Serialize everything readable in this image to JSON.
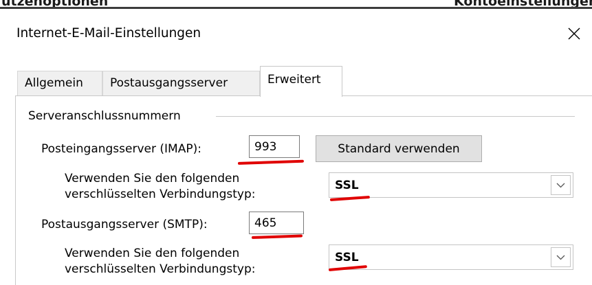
{
  "background_window": {
    "left_fragment": "utzenoptionen",
    "right_fragment": "Kontoeinstellungen"
  },
  "dialog": {
    "title": "Internet-E-Mail-Einstellungen",
    "close_icon": "close-icon"
  },
  "tabs": [
    {
      "label": "Allgemein",
      "active": false
    },
    {
      "label": "Postausgangsserver",
      "active": false
    },
    {
      "label": "Erweitert",
      "active": true
    }
  ],
  "server_ports": {
    "group_label": "Serveranschlussnummern",
    "incoming_label": "Posteingangsserver (IMAP):",
    "incoming_port": "993",
    "default_button": "Standard verwenden",
    "incoming_encryption_label_line1": "Verwenden Sie den folgenden",
    "incoming_encryption_label_line2": "verschlüsselten Verbindungstyp:",
    "incoming_encryption": "SSL",
    "outgoing_label": "Postausgangsserver (SMTP):",
    "outgoing_port": "465",
    "outgoing_encryption_label_line1": "Verwenden Sie den folgenden",
    "outgoing_encryption_label_line2": "verschlüsselten Verbindungstyp:",
    "outgoing_encryption": "SSL"
  },
  "colors": {
    "annotation_red": "#e00000",
    "active_tab": "#ffffff",
    "inactive_tab": "#f0f0f0",
    "button_face": "#e1e1e1"
  }
}
